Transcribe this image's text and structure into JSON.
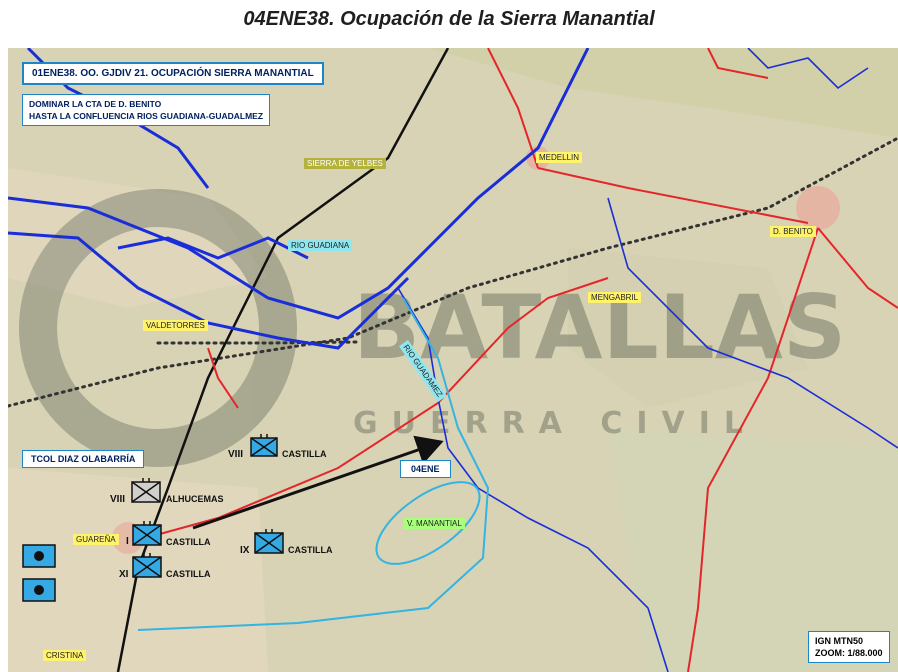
{
  "title": "04ENE38. Ocupación de la Sierra Manantial",
  "order_box": "01ENE38. OO. GJDIV 21. OCUPACIÓN SIERRA MANANTIAL",
  "objective_lines": [
    "DOMINAR  LA CTA DE D. BENITO",
    "HASTA LA  CONFLUENCIA RIOS GUADIANA-GUADALMEZ"
  ],
  "commander": "TCOL DIAZ OLABARRÍA",
  "date_label": "04ENE",
  "scale_lines": [
    "IGN MTN50",
    "ZOOM: 1/88.000"
  ],
  "watermark": [
    "BATALLAS",
    "GUERRA CIVIL"
  ],
  "places": {
    "medellin": "MEDELLIN",
    "don_benito": "D. BENITO",
    "mengabril": "MENGABRIL",
    "valdetorres": "VALDETORRES",
    "guarena": "GUAREÑA",
    "cristina": "CRISTINA",
    "sierra_yelbes": "SIERRA DE YELBES",
    "rio_guadiana": "RIO GUADIANA",
    "rio_guadamez": "RIO GUADAMEZ",
    "v_manantial": "V. MANANTIAL"
  },
  "units": [
    {
      "id": "viii-castilla",
      "numeral": "VIII",
      "name": "CASTILLA",
      "color": "#35a9e4"
    },
    {
      "id": "viii-alhucemas",
      "numeral": "VIII",
      "name": "ALHUCEMAS",
      "color": "#d0cfcb"
    },
    {
      "id": "i-castilla",
      "numeral": "I",
      "name": "CASTILLA",
      "color": "#35a9e4"
    },
    {
      "id": "xi-castilla",
      "numeral": "XI",
      "name": "CASTILLA",
      "color": "#35a9e4"
    },
    {
      "id": "ix-castilla",
      "numeral": "IX",
      "name": "CASTILLA",
      "color": "#35a9e4"
    }
  ],
  "hq_symbols": 2,
  "colors": {
    "river": "#1a2ed8",
    "road": "#e4262a",
    "railway": "#111111",
    "boundary": "#333333",
    "front_line": "#34b4e0",
    "advance_arrow": "#111111",
    "unit_friendly": "#35a9e4"
  }
}
